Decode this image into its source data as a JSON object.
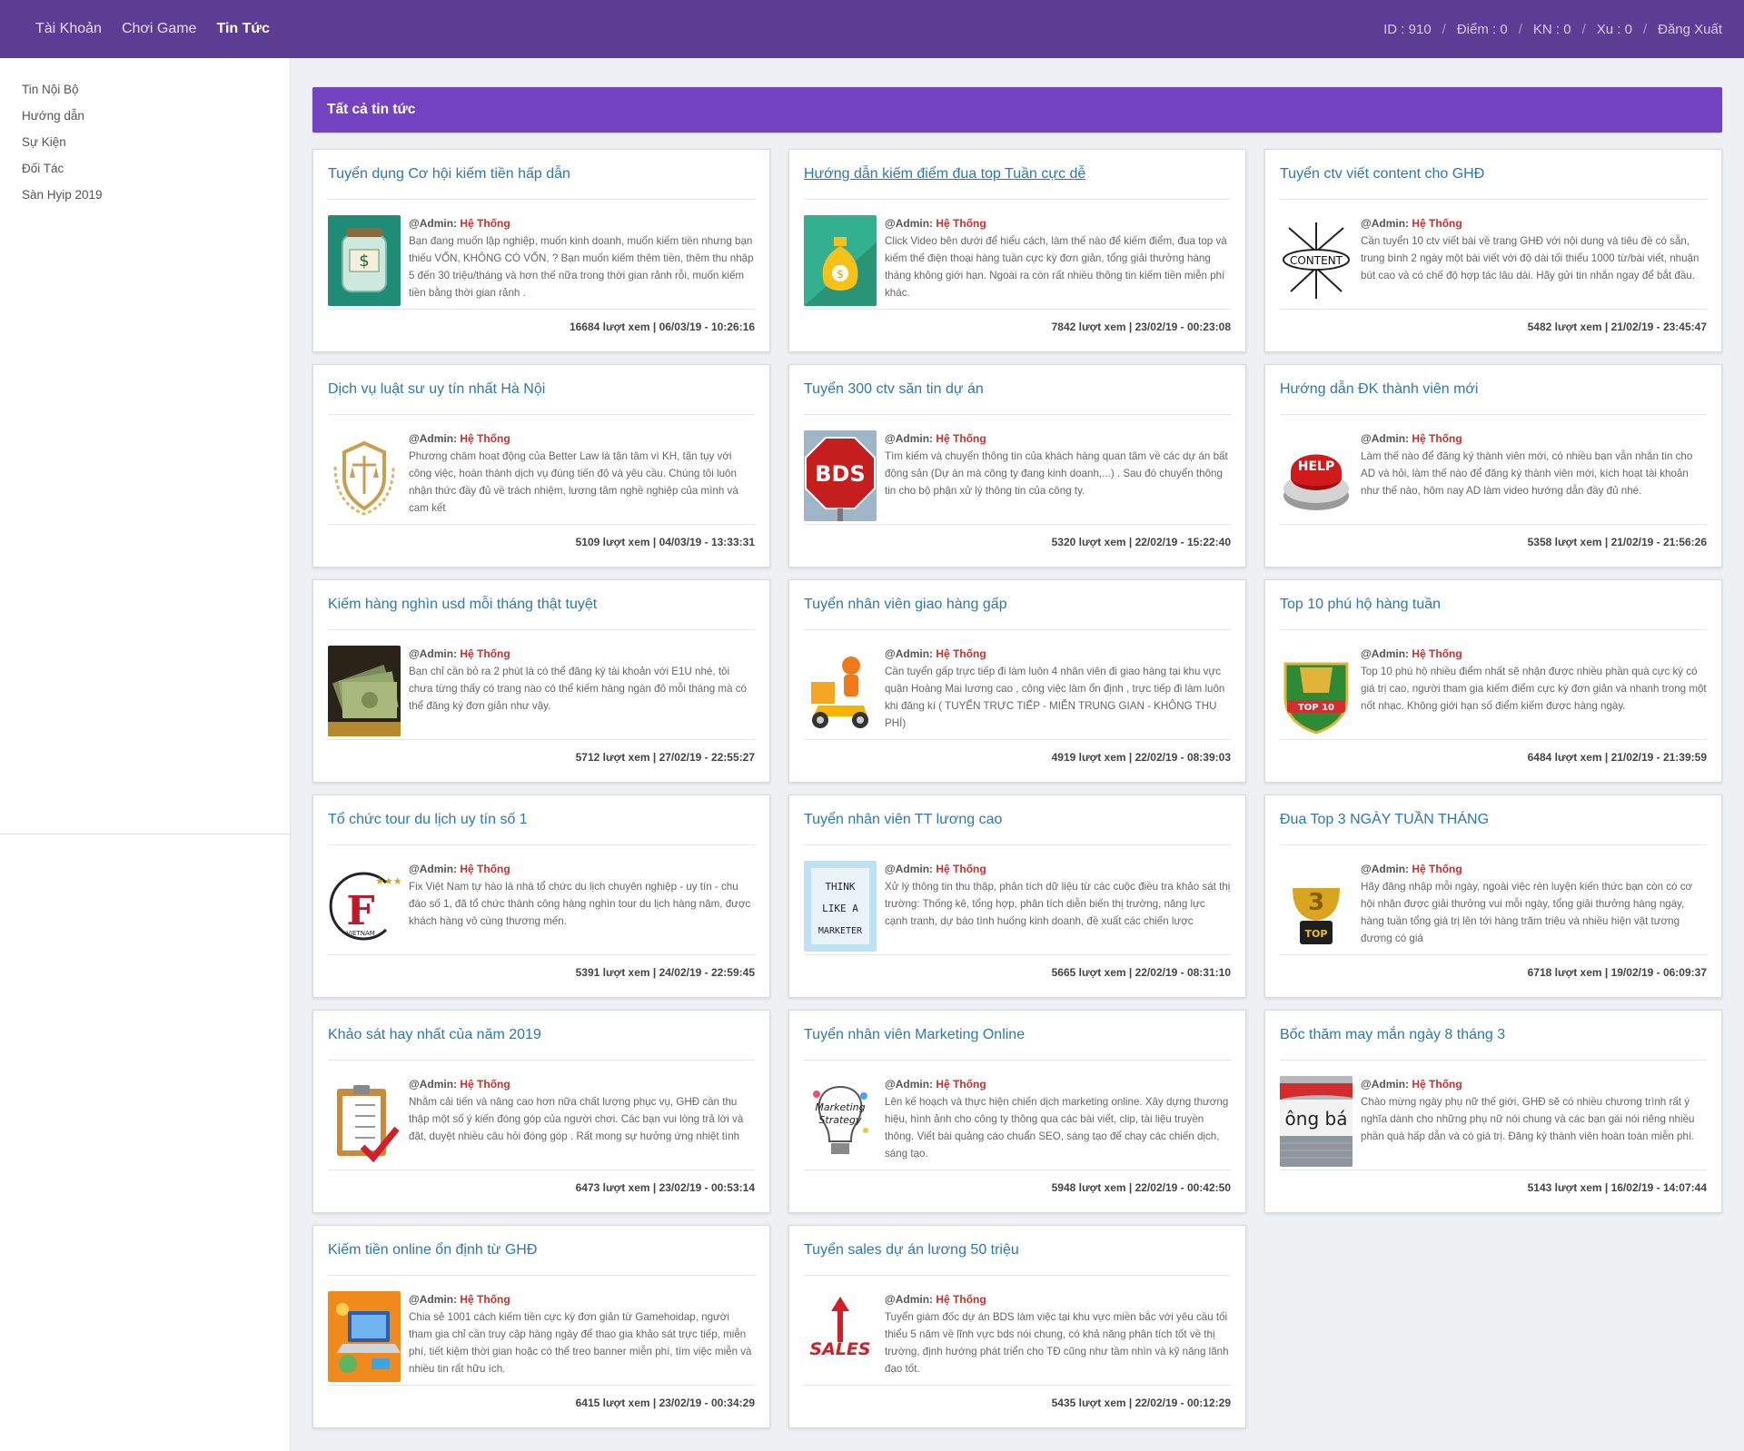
{
  "topbar": {
    "nav": [
      "Tài Khoản",
      "Chơi Game",
      "Tin Tức"
    ],
    "id": "ID : 910",
    "diem": "Điểm : 0",
    "kn": "KN : 0",
    "xu": "Xu : 0",
    "logout": "Đăng Xuất"
  },
  "sidebar": {
    "items": [
      "Tin Nội Bộ",
      "Hướng dẫn",
      "Sự Kiện",
      "Đối Tác",
      "Sàn Hyip 2019"
    ]
  },
  "page": {
    "header": "Tất cả tin tức"
  },
  "author_prefix": "@Admin:",
  "author_name": "Hệ Thống",
  "articles": [
    {
      "title": "Tuyển dụng Cơ hội kiếm tiền hấp dẫn",
      "icon": "money-jar-icon",
      "excerpt": "Bạn đang muốn lập nghiệp, muốn kinh doanh, muốn kiếm tiền nhưng bạn thiếu VỐN, KHÔNG CÓ VỐN, ? Bạn muốn kiếm thêm tiền, thêm thu nhập 5 đến 30 triệu/tháng và hơn thế nữa trong thời gian rảnh rỗi, muốn kiếm tiền bằng thời gian rảnh .",
      "meta": "16684 lượt xem | 06/03/19 - 10:26:16"
    },
    {
      "title": "Hướng dẫn kiếm điểm đua top Tuần cực dễ",
      "icon": "money-bag-icon",
      "excerpt": "Click Video bên dưới để hiểu cách, làm thế nào để kiếm điểm, đua top và kiếm thế điện thoại hàng tuần cực kỳ đơn giản, tổng giải thưởng hàng tháng không giới hạn. Ngoài ra còn rất nhiều thông tin kiếm tiền miễn phí khác.",
      "meta": "7842 lượt xem | 23/02/19 - 00:23:08"
    },
    {
      "title": "Tuyển ctv viết content cho GHĐ",
      "icon": "content-arrows-icon",
      "thumb_text": "CONTENT",
      "excerpt": "Cần tuyển 10 ctv viết bài về trang GHĐ với nội dung và tiêu đề có sẵn, trung bình 2 ngày một bài viết với độ dài tối thiểu 1000 từ/bài viết, nhuận bút cao và có chế độ hợp tác lâu dài. Hãy gửi tin nhắn ngay để bắt đầu.",
      "meta": "5482 lượt xem | 21/02/19 - 23:45:47"
    },
    {
      "title": "Dịch vụ luật sư uy tín nhất Hà Nội",
      "icon": "law-scale-shield-icon",
      "excerpt": "Phương châm hoạt động của Better Law là tận tâm vì KH, tận tụy với công việc, hoàn thành dịch vụ đúng tiến độ và yêu cầu. Chúng tôi luôn nhận thức đầy đủ về trách nhiệm, lương tâm nghề nghiệp của mình và cam kết",
      "meta": "5109 lượt xem | 04/03/19 - 13:33:31"
    },
    {
      "title": "Tuyển 300 ctv săn tin dự án",
      "icon": "bds-stop-sign-icon",
      "thumb_text": "BDS",
      "excerpt": "Tìm kiếm và chuyển thông tin của khách hàng quan tâm về các dự án bất động sản (Dự án mà công ty đang kinh doanh,...) . Sau đó chuyển thông tin cho bộ phận xử lý thông tin của công ty.",
      "meta": "5320 lượt xem | 22/02/19 - 15:22:40"
    },
    {
      "title": "Hướng dẫn ĐK thành viên mới",
      "icon": "help-button-icon",
      "thumb_text": "HELP",
      "excerpt": "Làm thế nào để đăng ký thành viên mới, có nhiều bạn vẫn nhắn tin cho AD và hỏi, làm thế nào để đăng ký thành viên mới, kích hoạt tài khoản như thế nào, hôm nay AD làm video hướng dẫn đầy đủ nhé.",
      "meta": "5358 lượt xem | 21/02/19 - 21:56:26"
    },
    {
      "title": "Kiếm hàng nghìn usd mỗi tháng thật tuyệt",
      "icon": "cash-stack-icon",
      "excerpt": "Bạn chỉ cần bỏ ra 2 phút là có thể đăng ký tài khoản với E1U nhé, tôi chưa từng thấy có trang nào có thể kiếm hàng ngàn đô mỗi tháng mà có thể đăng ký đơn giản như vậy.",
      "meta": "5712 lượt xem | 27/02/19 - 22:55:27"
    },
    {
      "title": "Tuyển nhân viên giao hàng gấp",
      "icon": "delivery-scooter-icon",
      "excerpt": "Cần tuyển gấp trực tiếp đi làm luôn 4 nhân viên đi giao hàng tại khu vực quận Hoàng Mai lương cao , công việc làm ổn định , trực tiếp đi làm luôn khi đăng kí ( TUYỂN TRỰC TIẾP - MIỄN TRUNG GIAN - KHÔNG THU PHÍ)",
      "meta": "4919 lượt xem | 22/02/19 - 08:39:03"
    },
    {
      "title": "Top 10 phú hộ hàng tuần",
      "icon": "champions-badge-icon",
      "thumb_text": "TOP 10",
      "excerpt": "Top 10 phú hộ nhiều điểm nhất sẽ nhận được nhiều phần quà cực kỳ có giá trị cao, người tham gia kiếm điểm cực kỳ đơn giản và nhanh trong một nốt nhạc. Không giới hạn số điểm kiếm được hàng ngày.",
      "meta": "6484 lượt xem | 21/02/19 - 21:39:59"
    },
    {
      "title": "Tổ chức tour du lịch uy tín số 1",
      "icon": "f-vietnam-logo-icon",
      "thumb_text": "VIETNAM",
      "excerpt": "Fix Việt Nam tự hào là nhà tổ chức du lịch chuyên nghiệp - uy tín - chu đáo số 1, đã tổ chức thành công hàng nghìn tour du lịch hàng năm, được khách hàng vô cùng thương mến.",
      "meta": "5391 lượt xem | 24/02/19 - 22:59:45"
    },
    {
      "title": "Tuyển nhân viên TT lương cao",
      "icon": "think-like-marketer-icon",
      "thumb_text": "THINK LIKE A MARKETER",
      "excerpt": "Xử lý thông tin thu thập, phân tích dữ liệu từ các cuộc điều tra khảo sát thị trường: Thống kê, tổng hợp, phân tích diễn biến thị trường, năng lực cạnh tranh, dự báo tình huống kinh doanh, đề xuất các chiến lược",
      "meta": "5665 lượt xem | 22/02/19 - 08:31:10"
    },
    {
      "title": "Đua Top 3 NGÀY TUẦN THÁNG",
      "icon": "top3-trophy-icon",
      "thumb_text": "TOP",
      "excerpt": "Hãy đăng nhập mỗi ngày, ngoài việc rèn luyện kiến thức bạn còn có cơ hội nhận được giải thưởng vui mỗi ngày, tổng giải thưởng hàng ngày, hàng tuần tổng giá trị lên tới hàng trăm triệu và nhiều hiện vật tương đương có giá",
      "meta": "6718 lượt xem | 19/02/19 - 06:09:37"
    },
    {
      "title": "Khảo sát hay nhất của năm 2019",
      "icon": "survey-clipboard-icon",
      "excerpt": "Nhằm cải tiến và nâng cao hơn nữa chất lượng phục vụ, GHĐ cần thu thập một số ý kiến đóng góp của người chơi. Các bạn vui lòng trả lời và đặt, duyệt nhiều câu hỏi đóng góp . Rất mong sự hưởng ứng nhiệt tình",
      "meta": "6473 lượt xem | 23/02/19 - 00:53:14"
    },
    {
      "title": "Tuyển nhân viên Marketing Online",
      "icon": "marketing-bulb-icon",
      "thumb_text": "Marketing Strategy",
      "excerpt": "Lên kế hoạch và thực hiện chiến dịch marketing online. Xây dựng thương hiệu, hình ảnh cho công ty thông qua các bài viết, clip, tài liệu truyền thông. Viết bài quảng cáo chuẩn SEO, sáng tạo để chạy các chiến dịch, sáng tạo.",
      "meta": "5948 lượt xem | 22/02/19 - 00:42:50"
    },
    {
      "title": "Bốc thăm may mắn ngày 8 tháng 3",
      "icon": "storefront-sign-icon",
      "thumb_text": "ông bá",
      "excerpt": "Chào mừng ngày phụ nữ thế giới, GHĐ sẽ có nhiều chương trình rất ý nghĩa dành cho những phụ nữ nói chung và các bạn gái nói riêng nhiều phần quà hấp dẫn và có giá trị. Đăng ký thành viên hoàn toàn miễn phí.",
      "meta": "5143 lượt xem | 16/02/19 - 14:07:44"
    },
    {
      "title": "Kiếm tiền online ổn định từ GHĐ",
      "icon": "laptop-money-icon",
      "excerpt": "Chia sẻ 1001 cách kiếm tiền cực kỳ đơn giản từ Gamehoidap, người tham gia chỉ cần truy cập hàng ngày để thao gia khảo sát trực tiếp, miễn phí, tiết kiệm thời gian hoặc có thể treo banner miễn phí, tìm việc miễn và nhiều tin rất hữu ích.",
      "meta": "6415 lượt xem | 23/02/19 - 00:34:29"
    },
    {
      "title": "Tuyển sales dự án lương 50 triệu",
      "icon": "sales-arrow-icon",
      "thumb_text": "SALES",
      "excerpt": "Tuyển giám đốc dự án BDS làm việc tại khu vực miền bắc với yêu cầu tối thiểu 5 năm về lĩnh vực bds nói chung, có khả năng phân tích tốt về thị trường, định hướng phát triển cho TĐ cũng như tầm nhìn và kỹ năng lãnh đạo tốt.",
      "meta": "5435 lượt xem | 22/02/19 - 00:12:29"
    }
  ]
}
